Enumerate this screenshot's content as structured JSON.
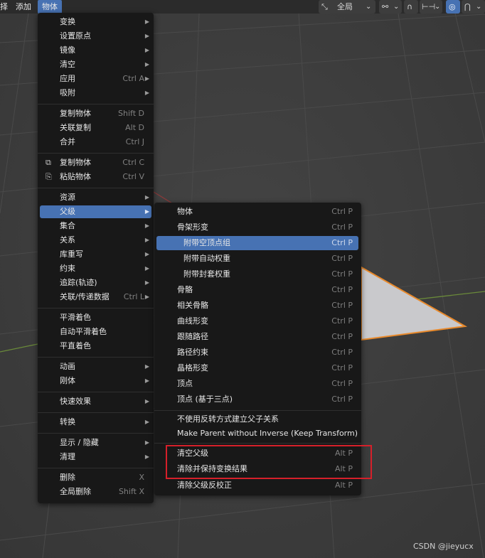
{
  "topbar": {
    "left_items": [
      "择",
      "添加",
      "物体"
    ],
    "transform_orientation": "全局",
    "dropdown_glyph": "⌄",
    "icons": [
      "transform-orientation-icon",
      "pivot-link-icon",
      "snap-magnet-icon",
      "snap-increment-icon",
      "proportional-edit-icon",
      "falloff-curve-icon"
    ]
  },
  "main_menu": {
    "items": [
      {
        "label": "变换",
        "shortcut": "",
        "submenu": true
      },
      {
        "label": "设置原点",
        "shortcut": "",
        "submenu": true
      },
      {
        "label": "镜像",
        "shortcut": "",
        "submenu": true
      },
      {
        "label": "清空",
        "shortcut": "",
        "submenu": true
      },
      {
        "label": "应用",
        "shortcut": "Ctrl A",
        "submenu": true
      },
      {
        "label": "吸附",
        "shortcut": "",
        "submenu": true
      },
      {
        "label": "复制物体",
        "shortcut": "Shift D",
        "submenu": false
      },
      {
        "label": "关联复制",
        "shortcut": "Alt D",
        "submenu": false
      },
      {
        "label": "合并",
        "shortcut": "Ctrl J",
        "submenu": false
      },
      {
        "label": "复制物体",
        "shortcut": "Ctrl C",
        "submenu": false,
        "icon": "copy-icon"
      },
      {
        "label": "粘贴物体",
        "shortcut": "Ctrl V",
        "submenu": false,
        "icon": "paste-icon"
      },
      {
        "label": "资源",
        "shortcut": "",
        "submenu": true
      },
      {
        "label": "父级",
        "shortcut": "",
        "submenu": true,
        "highlighted": true
      },
      {
        "label": "集合",
        "shortcut": "",
        "submenu": true
      },
      {
        "label": "关系",
        "shortcut": "",
        "submenu": true
      },
      {
        "label": "库重写",
        "shortcut": "",
        "submenu": true
      },
      {
        "label": "约束",
        "shortcut": "",
        "submenu": true
      },
      {
        "label": "追踪(轨迹)",
        "shortcut": "",
        "submenu": true
      },
      {
        "label": "关联/传递数据",
        "shortcut": "Ctrl L",
        "submenu": true
      },
      {
        "label": "平滑着色",
        "shortcut": "",
        "submenu": false
      },
      {
        "label": "自动平滑着色",
        "shortcut": "",
        "submenu": false
      },
      {
        "label": "平直着色",
        "shortcut": "",
        "submenu": false
      },
      {
        "label": "动画",
        "shortcut": "",
        "submenu": true
      },
      {
        "label": "刚体",
        "shortcut": "",
        "submenu": true
      },
      {
        "label": "快速效果",
        "shortcut": "",
        "submenu": true
      },
      {
        "label": "转换",
        "shortcut": "",
        "submenu": true
      },
      {
        "label": "显示 / 隐藏",
        "shortcut": "",
        "submenu": true
      },
      {
        "label": "清理",
        "shortcut": "",
        "submenu": true
      },
      {
        "label": "删除",
        "shortcut": "X",
        "submenu": false
      },
      {
        "label": "全局删除",
        "shortcut": "Shift X",
        "submenu": false
      }
    ]
  },
  "parent_submenu": {
    "items": [
      {
        "label": "物体",
        "shortcut": "Ctrl P"
      },
      {
        "label": "骨架形变",
        "shortcut": "Ctrl P"
      },
      {
        "label": "附带空顶点组",
        "shortcut": "Ctrl P",
        "highlighted": true,
        "indent": true
      },
      {
        "label": "附带自动权重",
        "shortcut": "Ctrl P",
        "indent": true
      },
      {
        "label": "附带封套权重",
        "shortcut": "Ctrl P",
        "indent": true
      },
      {
        "label": "骨骼",
        "shortcut": "Ctrl P"
      },
      {
        "label": "相关骨骼",
        "shortcut": "Ctrl P"
      },
      {
        "label": "曲线形变",
        "shortcut": "Ctrl P"
      },
      {
        "label": "跟随路径",
        "shortcut": "Ctrl P"
      },
      {
        "label": "路径约束",
        "shortcut": "Ctrl P"
      },
      {
        "label": "晶格形变",
        "shortcut": "Ctrl P"
      },
      {
        "label": "顶点",
        "shortcut": "Ctrl P"
      },
      {
        "label": "顶点 (基于三点)",
        "shortcut": "Ctrl P"
      },
      {
        "label": "不使用反转方式建立父子关系",
        "shortcut": ""
      },
      {
        "label": "Make Parent without Inverse (Keep Transform)",
        "shortcut": ""
      },
      {
        "label": "清空父级",
        "shortcut": "Alt P"
      },
      {
        "label": "清除并保持变换结果",
        "shortcut": "Alt P"
      },
      {
        "label": "清除父级反校正",
        "shortcut": "Alt P"
      }
    ]
  },
  "colors": {
    "highlight": "#4772b3",
    "menu_bg": "#181818",
    "annotation_box": "#d6202a",
    "mesh_fill": "#c9c9cc",
    "mesh_outline": "#e8892b"
  },
  "watermark": "CSDN @jieyucx"
}
